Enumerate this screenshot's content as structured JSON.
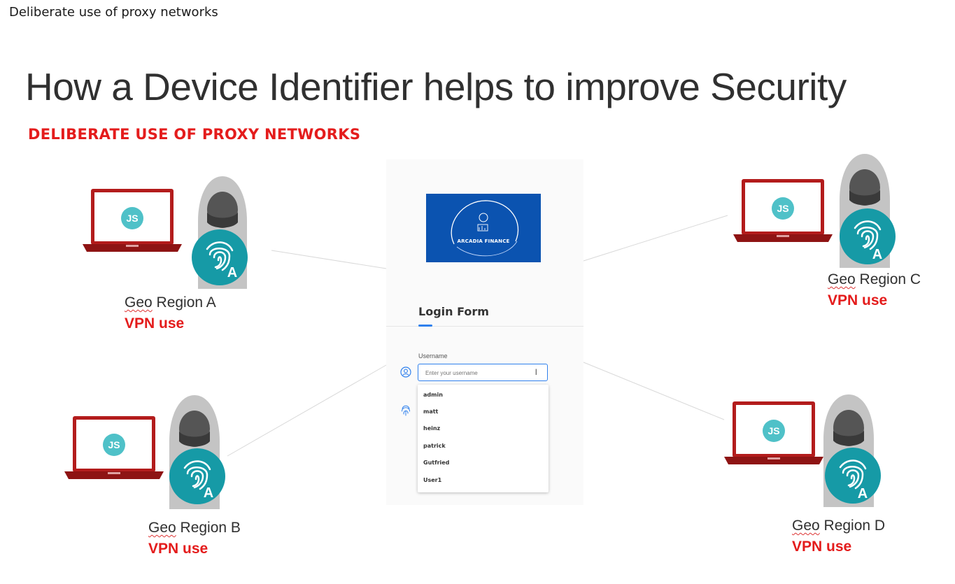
{
  "header": {
    "caption": "Deliberate use of proxy networks"
  },
  "slide": {
    "title": "How a Device Identifier helps to improve Security",
    "subtitle": "DELIBERATE USE OF PROXY NETWORKS"
  },
  "regions": [
    {
      "geo_word": "Geo",
      "geo_rest": " Region A",
      "vpn": "VPN use",
      "avatar": "JS",
      "badge": "A"
    },
    {
      "geo_word": "Geo",
      "geo_rest": " Region B",
      "vpn": "VPN use",
      "avatar": "JS",
      "badge": "A"
    },
    {
      "geo_word": "Geo",
      "geo_rest": " Region C",
      "vpn": "VPN use",
      "avatar": "JS",
      "badge": "A"
    },
    {
      "geo_word": "Geo",
      "geo_rest": " Region D",
      "vpn": "VPN use",
      "avatar": "JS",
      "badge": "A"
    }
  ],
  "login": {
    "brand": "ARCADIA FINANCE",
    "title": "Login Form",
    "username_label": "Username",
    "username_placeholder": "Enter your username",
    "options": [
      "admin",
      "matt",
      "heinz",
      "patrick",
      "Gutfried",
      "User1"
    ]
  },
  "colors": {
    "accent_red": "#e41c1c",
    "laptop_red": "#b31c1c",
    "avatar_teal": "#4fc1c8",
    "fingerprint_teal": "#169aa6",
    "brand_blue": "#0b53b0",
    "focus_blue": "#2f80ed"
  },
  "icons": [
    "laptop-icon",
    "hooded-figure-icon",
    "fingerprint-badge-icon",
    "user-icon",
    "fingerprint-icon",
    "text-cursor-icon"
  ]
}
